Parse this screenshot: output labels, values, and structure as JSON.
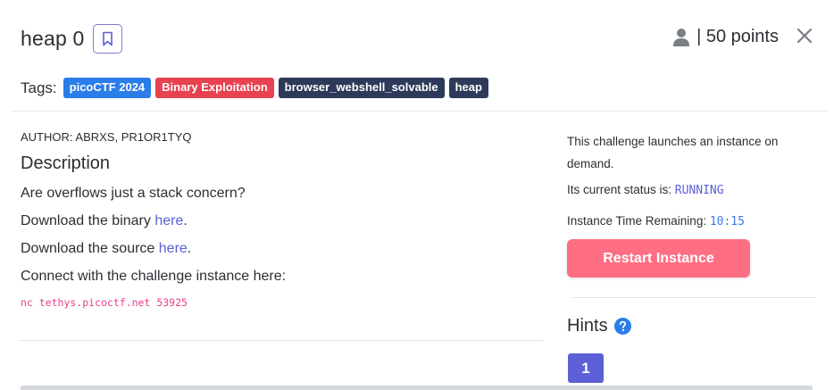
{
  "challenge": {
    "title": "heap 0",
    "points": "| 50 points",
    "tags_label": "Tags:",
    "tags": [
      {
        "label": "picoCTF 2024",
        "color": "#2b7de9"
      },
      {
        "label": "Binary Exploitation",
        "color": "#e8414f"
      },
      {
        "label": "browser_webshell_solvable",
        "color": "#2e3a59"
      },
      {
        "label": "heap",
        "color": "#2e3a59"
      }
    ]
  },
  "left": {
    "author": "AUTHOR: ABRXS, PR1OR1TYQ",
    "description_heading": "Description",
    "line1": "Are overflows just a stack concern?",
    "line2_prefix": "Download the binary ",
    "line2_link": "here",
    "line2_suffix": ".",
    "line3_prefix": "Download the source ",
    "line3_link": "here",
    "line3_suffix": ".",
    "line4": "Connect with the challenge instance here:",
    "command": "nc tethys.picoctf.net 53925"
  },
  "instance": {
    "launch_text": "This challenge launches an instance on demand.",
    "status_label": "Its current status is: ",
    "status_value": "RUNNING",
    "time_label": "Instance Time Remaining: ",
    "time_value": "10:15",
    "restart_label": "Restart Instance"
  },
  "hints": {
    "title": "Hints",
    "items": [
      "1"
    ]
  },
  "colors": {
    "accent": "#5c5fd6",
    "restart": "#fe6f83",
    "command": "#e83e8c",
    "help": "#2b7de9"
  },
  "icons": [
    "bookmark-icon",
    "user-icon",
    "close-icon",
    "help-icon"
  ]
}
